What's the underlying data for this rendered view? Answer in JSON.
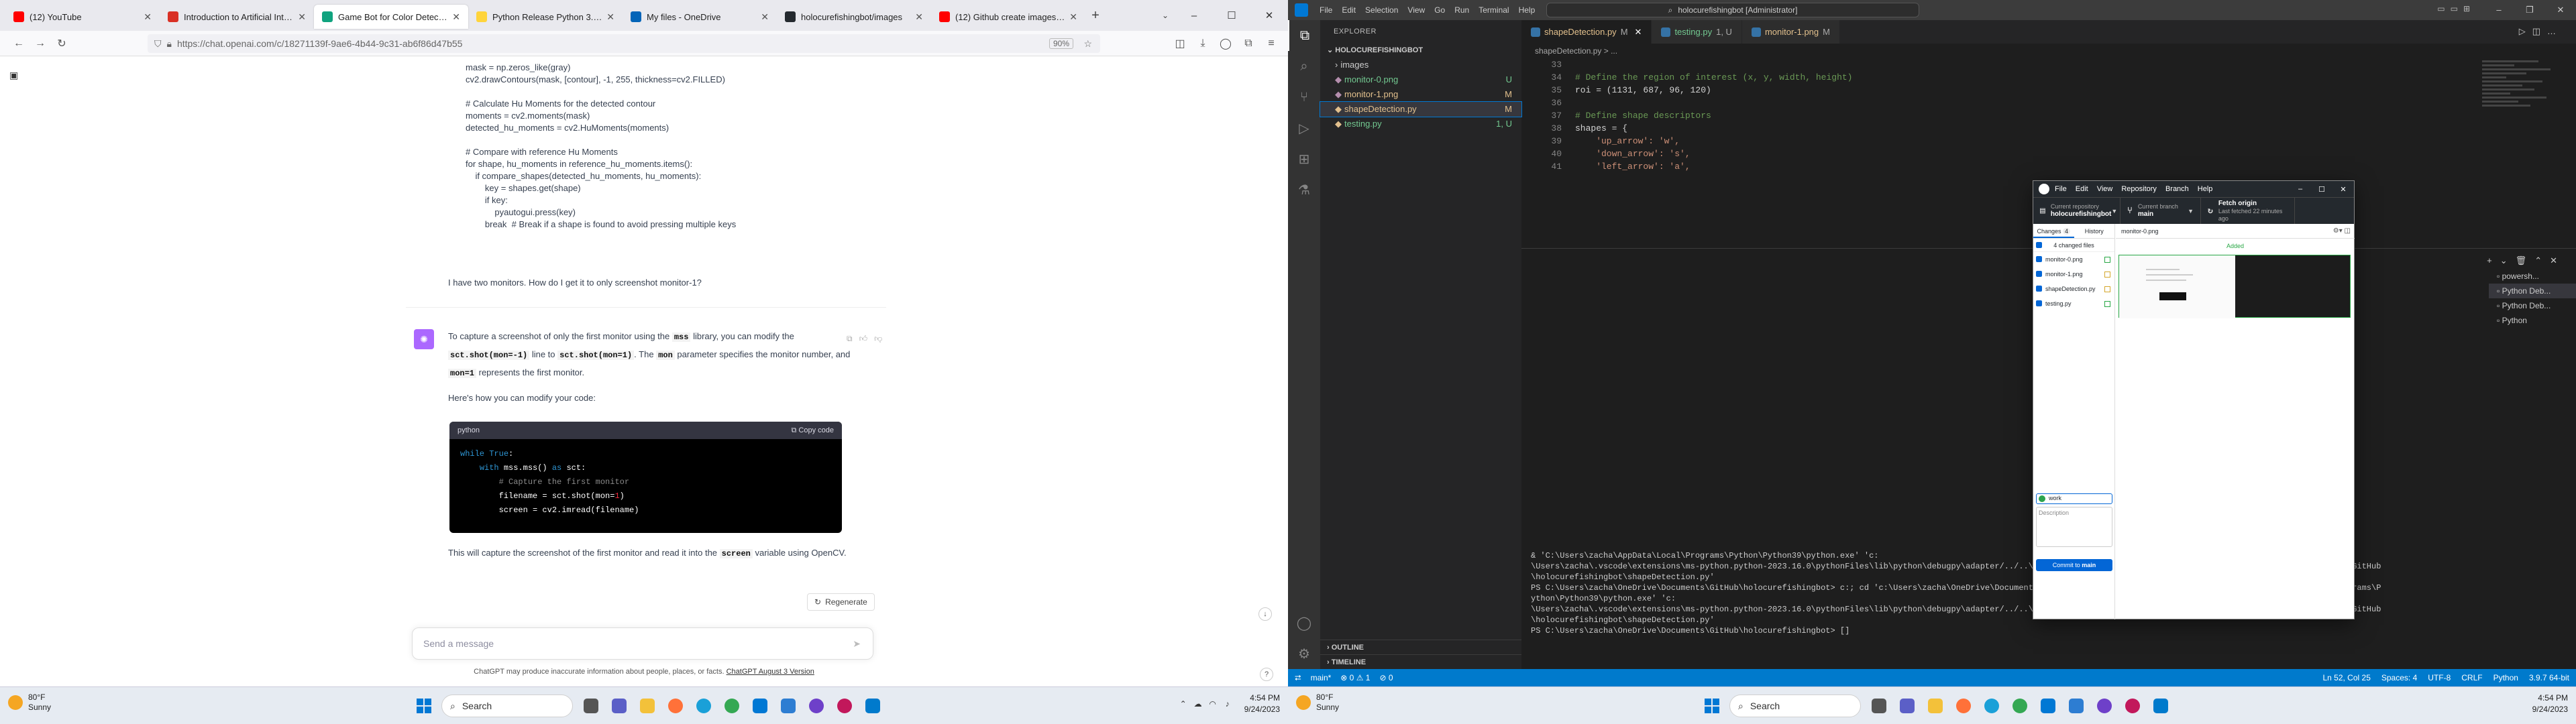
{
  "browser": {
    "tabs": [
      {
        "label": "(12) YouTube",
        "color": "#ff0000"
      },
      {
        "label": "Introduction to Artificial Intellig",
        "color": "#d93025"
      },
      {
        "label": "Game Bot for Color Detection",
        "color": "#10a37f",
        "active": true
      },
      {
        "label": "Python Release Python 3.11.5",
        "color": "#ffd43b"
      },
      {
        "label": "My files - OneDrive",
        "color": "#0364b8"
      },
      {
        "label": "holocurefishingbot/images",
        "color": "#24292e"
      },
      {
        "label": "(12) Github create images fold",
        "color": "#ff0000"
      }
    ],
    "url": "https://chat.openai.com/c/18271139f-9ae6-4b44-9c31-ab6f86d47b55",
    "zoom": "90%"
  },
  "chat": {
    "code_preview": [
      "mask = np.zeros_like(gray)",
      "cv2.drawContours(mask, [contour], -1, 255, thickness=cv2.FILLED)",
      "",
      "# Calculate Hu Moments for the detected contour",
      "moments = cv2.moments(mask)",
      "detected_hu_moments = cv2.HuMoments(moments)",
      "",
      "# Compare with reference Hu Moments",
      "for shape, hu_moments in reference_hu_moments.items():",
      "    if compare_shapes(detected_hu_moments, hu_moments):",
      "        key = shapes.get(shape)",
      "        if key:",
      "            pyautogui.press(key)",
      "        break  # Break if a shape is found to avoid pressing multiple keys"
    ],
    "user_question": "I have two monitors. How do I get it to only screenshot monitor-1?",
    "answer_p1_a": "To capture a screenshot of only the first monitor using the ",
    "answer_mss": "mss",
    "answer_p1_b": " library, you can modify the ",
    "answer_code1": "sct.shot(mon=-1)",
    "answer_p1_c": " line to ",
    "answer_code2": "sct.shot(mon=1)",
    "answer_p1_d": ". The ",
    "answer_code3": "mon",
    "answer_p1_e": " parameter specifies the monitor number, and ",
    "answer_code4": "mon=1",
    "answer_p1_f": " represents the first monitor.",
    "answer_p2": "Here's how you can modify your code:",
    "code_lang": "python",
    "copy_label": "Copy code",
    "answer_p3_a": "This will capture the screenshot of the first monitor and read it into the ",
    "answer_code5": "screen",
    "answer_p3_b": " variable using OpenCV.",
    "regenerate_label": "Regenerate",
    "send_placeholder": "Send a message",
    "disclaimer_a": "ChatGPT may produce inaccurate information about people, places, or facts. ",
    "disclaimer_link": "ChatGPT August 3 Version"
  },
  "taskbar": {
    "temp": "80°F",
    "weather": "Sunny",
    "search": "Search",
    "time": "4:54 PM",
    "date": "9/24/2023"
  },
  "vscode": {
    "menu": [
      "File",
      "Edit",
      "Selection",
      "View",
      "Go",
      "Run",
      "Terminal",
      "Help"
    ],
    "command_center": "holocurefishingbot [Administrator]",
    "explorer_title": "EXPLORER",
    "root_folder": "HOLOCUREFISHINGBOT",
    "files": [
      {
        "name": "images",
        "status": ""
      },
      {
        "name": "monitor-0.png",
        "status": "U"
      },
      {
        "name": "monitor-1.png",
        "status": "M"
      },
      {
        "name": "shapeDetection.py",
        "status": "M"
      },
      {
        "name": "testing.py",
        "status": "1, U"
      }
    ],
    "outline_label": "OUTLINE",
    "timeline_label": "TIMELINE",
    "tabs": [
      {
        "label": "shapeDetection.py",
        "suffix": "M"
      },
      {
        "label": "testing.py",
        "suffix": "1, U"
      },
      {
        "label": "monitor-1.png",
        "suffix": "M"
      }
    ],
    "breadcrumb": "shapeDetection.py > ...",
    "code_lines": [
      {
        "n": "33",
        "t": "",
        "c": ""
      },
      {
        "n": "34",
        "t": "# Define the region of interest (x, y, width, height)",
        "c": "ccm"
      },
      {
        "n": "35",
        "t": "roi = (1131, 687, 96, 120)",
        "c": ""
      },
      {
        "n": "36",
        "t": "",
        "c": ""
      },
      {
        "n": "37",
        "t": "# Define shape descriptors",
        "c": "ccm"
      },
      {
        "n": "38",
        "t": "shapes = {",
        "c": ""
      },
      {
        "n": "39",
        "t": "    'up_arrow': 'w',",
        "c": "cstr"
      },
      {
        "n": "40",
        "t": "    'down_arrow': 's',",
        "c": "cstr"
      },
      {
        "n": "41",
        "t": "    'left_arrow': 'a',",
        "c": "cstr"
      }
    ],
    "terminal_lines": [
      "& 'C:\\Users\\zacha\\AppData\\Local\\Programs\\Python\\Python39\\python.exe' 'c:",
      "\\Users\\zacha\\.vscode\\extensions\\ms-python.python-2023.16.0\\pythonFiles\\lib\\python\\debugpy\\adapter/../..\\debugpy\\launcher' '61185' '--' 'C:\\Users\\zacha\\OneDrive\\Documents\\GitHub\\holocurefishingbot\\shapeDetection.py'",
      "PS C:\\Users\\zacha\\OneDrive\\Documents\\GitHub\\holocurefishingbot> c:; cd 'c:\\Users\\zacha\\OneDrive\\Documents\\GitHub\\holocurefishingbot'; & 'C:\\Users\\zacha\\AppData\\Local\\Programs\\Python\\Python39\\python.exe' 'c:",
      "\\Users\\zacha\\.vscode\\extensions\\ms-python.python-2023.16.0\\pythonFiles\\lib\\python\\debugpy\\adapter/../..\\debugpy\\launcher' '61185' '--' 'C:\\Users\\zacha\\OneDrive\\Documents\\GitHub\\holocurefishingbot\\shapeDetection.py'",
      "PS C:\\Users\\zacha\\OneDrive\\Documents\\GitHub\\holocurefishingbot> []"
    ],
    "terminal_tabs": [
      "powersh...",
      "Python Deb...",
      "Python Deb...",
      "Python"
    ],
    "status_left": [
      "main*",
      "⊗ 0 ⚠ 1",
      "⊘ 0"
    ],
    "status_right": [
      "Ln 52, Col 25",
      "Spaces: 4",
      "UTF-8",
      "CRLF",
      "Python",
      "3.9.7 64-bit"
    ]
  },
  "github_desktop": {
    "menu": [
      "File",
      "Edit",
      "View",
      "Repository",
      "Branch",
      "Help"
    ],
    "repo_label": "Current repository",
    "repo": "holocurefishingbot",
    "branch_label": "Current branch",
    "branch": "main",
    "fetch_label": "Fetch origin",
    "fetch_sub": "Last fetched 22 minutes ago",
    "tab_changes": "Changes",
    "changes_count": "4",
    "tab_history": "History",
    "changed_files_label": "4 changed files",
    "files": [
      {
        "name": "monitor-0.png",
        "kind": "add"
      },
      {
        "name": "monitor-1.png",
        "kind": "mod"
      },
      {
        "name": "shapeDetection.py",
        "kind": "mod"
      },
      {
        "name": "testing.py",
        "kind": "add"
      }
    ],
    "diff_file": "monitor-0.png",
    "added_label": "Added",
    "summary": "work",
    "description_placeholder": "Description",
    "commit_prefix": "Commit to ",
    "commit_branch": "main"
  },
  "taskbar2": {
    "temp": "80°F",
    "weather": "Sunny",
    "search": "Search",
    "time": "4:54 PM",
    "date": "9/24/2023"
  }
}
